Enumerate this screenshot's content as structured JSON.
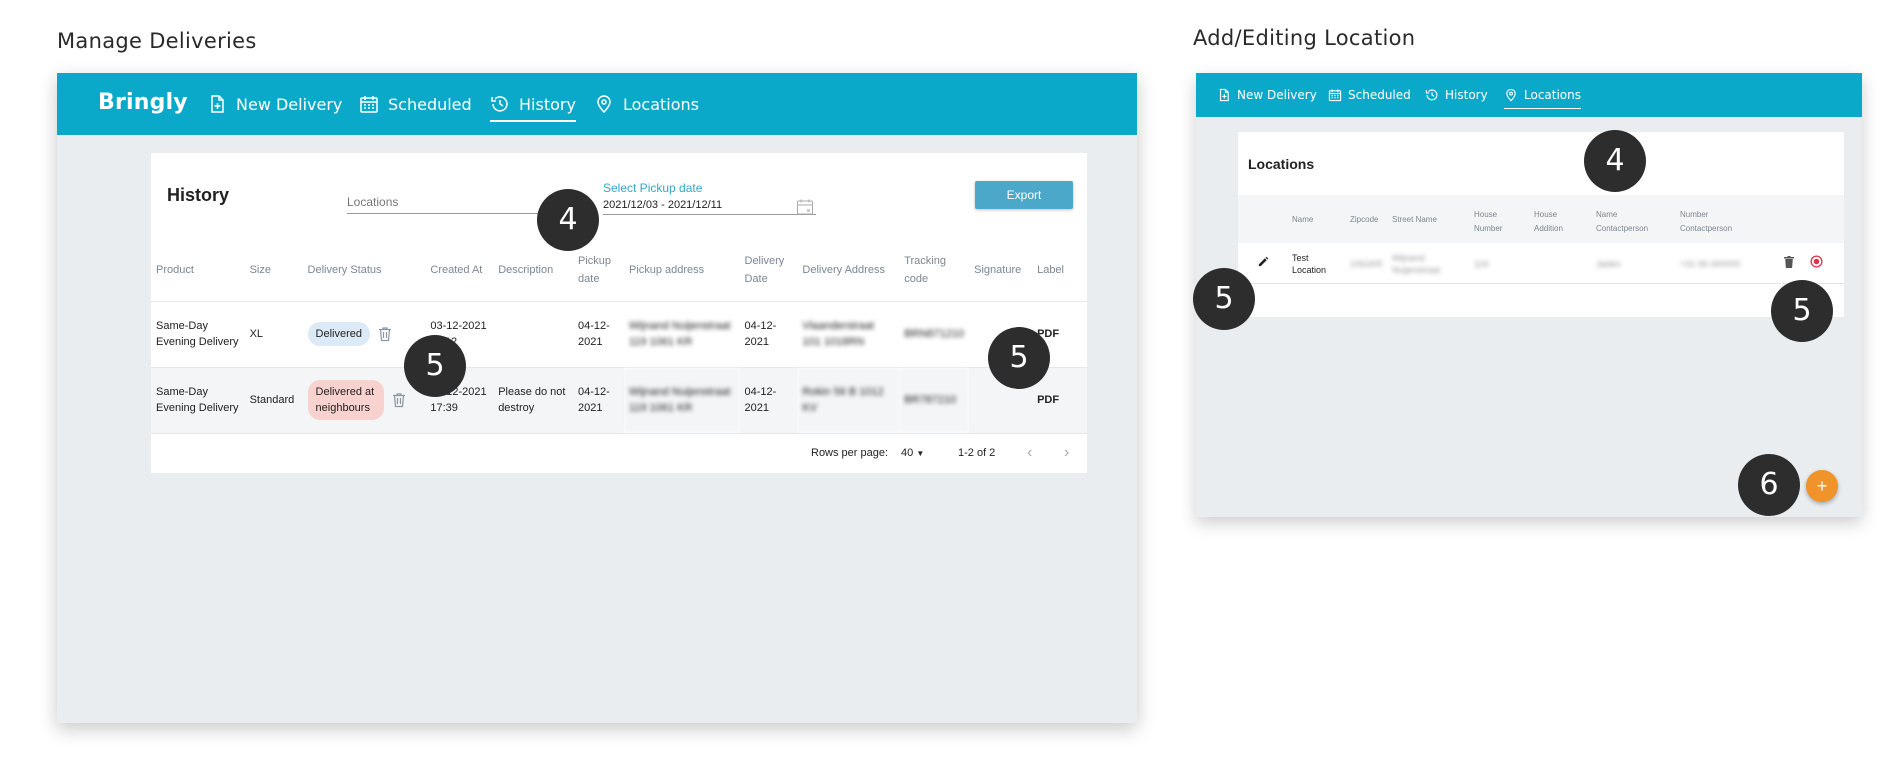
{
  "left_section": {
    "title": "Manage Deliveries",
    "brand": "Bringly",
    "nav": [
      {
        "label": "New Delivery",
        "icon": "file-plus-icon",
        "active": false
      },
      {
        "label": "Scheduled",
        "icon": "calendar-icon",
        "active": false
      },
      {
        "label": "History",
        "icon": "history-icon",
        "active": true
      },
      {
        "label": "Locations",
        "icon": "map-pin-icon",
        "active": false
      }
    ],
    "card": {
      "title": "History",
      "locations_placeholder": "Locations",
      "date_label": "Select Pickup date",
      "date_value": "2021/12/03 - 2021/12/11",
      "export_label": "Export"
    },
    "table": {
      "headers": [
        "Product",
        "Size",
        "Delivery Status",
        "Created At",
        "Description",
        "Pickup date",
        "Pickup address",
        "Delivery Date",
        "Delivery Address",
        "Tracking code",
        "Signature",
        "Label"
      ],
      "rows": [
        {
          "product": "Same-Day Evening Delivery",
          "size": "XL",
          "status": "Delivered",
          "created_at": "03-12-2021 11:12",
          "description": "",
          "pickup_date": "04-12-2021",
          "pickup_address": "Wijnand Nuijenstraat 119 1061 KR",
          "delivery_date": "04-12-2021",
          "delivery_address": "Vlaanderstraat 101 1018RN",
          "tracking_code": "BRN871210",
          "signature": "",
          "label": "PDF"
        },
        {
          "product": "Same-Day Evening Delivery",
          "size": "Standard",
          "status": "Delivered at neighbours",
          "created_at": "03-12-2021 17:39",
          "description": "Please do not destroy",
          "pickup_date": "04-12-2021",
          "pickup_address": "Wijnand Nuijenstraat 119 1061 KR",
          "delivery_date": "04-12-2021",
          "delivery_address": "Rokin 56 B 1012 KV",
          "tracking_code": "BR787210",
          "signature": "",
          "label": "PDF"
        }
      ]
    },
    "pager": {
      "rows_per_page_label": "Rows per page:",
      "rows_per_page_value": "40",
      "range": "1-2 of 2"
    }
  },
  "right_section": {
    "title": "Add/Editing Location",
    "nav": [
      {
        "label": "New Delivery",
        "icon": "file-plus-icon",
        "active": false
      },
      {
        "label": "Scheduled",
        "icon": "calendar-icon",
        "active": false
      },
      {
        "label": "History",
        "icon": "history-icon",
        "active": false
      },
      {
        "label": "Locations",
        "icon": "map-pin-icon",
        "active": true
      }
    ],
    "card": {
      "title": "Locations",
      "headers": [
        "Name",
        "Zipcode",
        "Street Name",
        "House Number",
        "House Addition",
        "Name Contactperson",
        "Number Contactperson"
      ],
      "row": {
        "name": "Test Location",
        "zipcode": "1061KR",
        "street": "Wijnand Nuijenstraat",
        "house_number": "119",
        "house_addition": "",
        "contact_name": "Jaden",
        "contact_number": "+31 06 000000"
      }
    },
    "fab_label": "+"
  },
  "annotations": {
    "left_4": "4",
    "left_5a": "5",
    "left_5b": "5",
    "right_4": "4",
    "right_5a": "5",
    "right_5b": "5",
    "right_6": "6"
  },
  "colors": {
    "nav_bg": "#0aa9c9",
    "export_btn": "#4ba8c9",
    "badge_delivered": "#dbeaf6",
    "badge_neighbours": "#f7d2cf",
    "fab": "#f0932b",
    "bubble": "#2d2d2d"
  }
}
